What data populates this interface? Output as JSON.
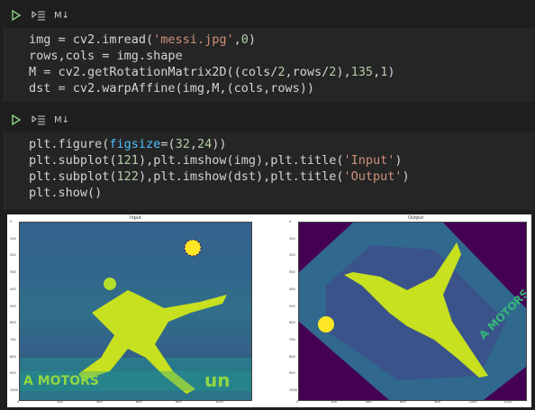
{
  "cell1": {
    "toolbar": {
      "run_icon": "play-icon",
      "exec_icon": "execute-above-icon",
      "md_label": "M↓"
    },
    "lines": [
      [
        "img = cv2.imread(",
        "'messi.jpg'",
        ",",
        "0",
        ")"
      ],
      [
        "rows,cols = img.shape"
      ],
      [
        "M = cv2.getRotationMatrix2D((cols/",
        "2",
        ",rows/",
        "2",
        "),",
        "135",
        ",",
        "1",
        ")"
      ],
      [
        "dst = cv2.warpAffine(img,M,(cols,rows))"
      ]
    ]
  },
  "cell2": {
    "toolbar": {
      "run_icon": "play-icon",
      "exec_icon": "execute-above-icon",
      "md_label": "M↓"
    },
    "lines": [
      [
        "plt.figure(",
        "figsize",
        "=(",
        "32",
        ",",
        "24",
        "))"
      ],
      [
        "plt.subplot(",
        "121",
        "),plt.imshow(img),plt.title(",
        "'Input'",
        ")"
      ],
      [
        "plt.subplot(",
        "122",
        "),plt.imshow(dst),plt.title(",
        "'Output'",
        ")"
      ],
      [
        "plt.show()"
      ]
    ]
  },
  "output": {
    "left_title": "Input",
    "right_title": "Output",
    "yticks": [
      "0",
      "100",
      "200",
      "300",
      "400",
      "500",
      "600",
      "700",
      "800",
      "900",
      "1000"
    ],
    "xticks": [
      "0",
      "200",
      "400",
      "600",
      "800",
      "1000",
      "1200"
    ],
    "left_banner_text": "A MOTORS",
    "left_banner_text2": "un",
    "right_banner_text": "A MOTORS",
    "colors": {
      "viridis_dark": "#440154",
      "viridis_mid": "#31688e",
      "viridis_teal": "#35b779",
      "viridis_yellow": "#fde725"
    }
  }
}
